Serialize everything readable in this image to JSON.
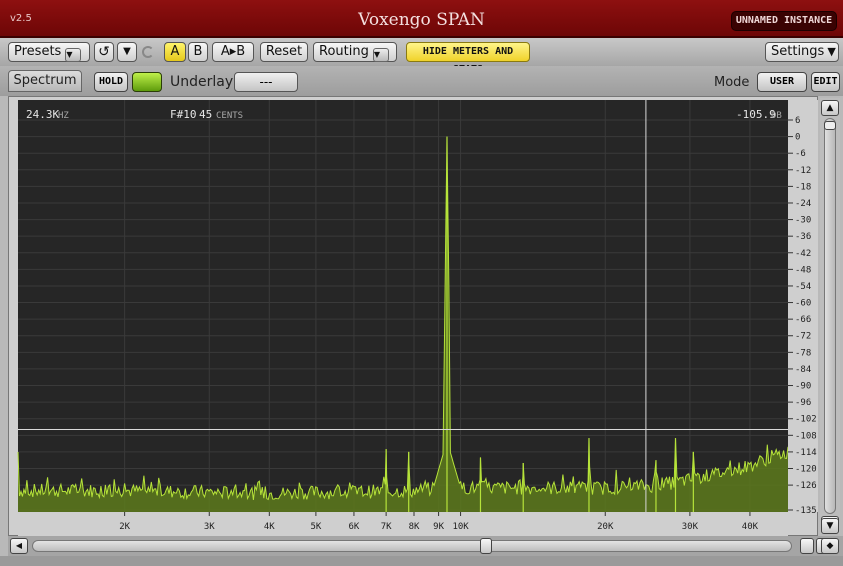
{
  "title_bar": {
    "version": "v2.5",
    "title": "Voxengo SPAN",
    "instance_label": "UNNAMED INSTANCE"
  },
  "toolbar": {
    "presets_label": "Presets",
    "undo_icon": "undo-icon",
    "a_label": "A",
    "b_label": "B",
    "a_to_b_label": "A▸B",
    "reset_label": "Reset",
    "routing_label": "Routing",
    "hide_meters_label": "HIDE METERS AND STATS",
    "settings_label": "Settings"
  },
  "view_bar": {
    "tab_label": "Spectrum",
    "hold_label": "HOLD",
    "underlay_label": "Underlay",
    "underlay_value": "---",
    "mode_label": "Mode",
    "mode_value": "USER",
    "edit_label": "EDIT"
  },
  "readout": {
    "frequency": "24.3K",
    "frequency_unit": "HZ",
    "note": "F#10",
    "cents": "45",
    "cents_unit": "CENTS",
    "level": "-105.9",
    "level_unit": "DB"
  },
  "colors": {
    "title_bar": "#7d0a0a",
    "plot_background": "#262626",
    "spectrum_line": "#b6e33a",
    "spectrum_fill": "#5d7a1c",
    "accent_yellow": "#f3d733"
  },
  "chart_data": {
    "type": "area",
    "x_scale": "log",
    "x_unit": "Hz",
    "y_unit": "dB",
    "xlim": [
      1200,
      48000
    ],
    "ylim": [
      -135,
      6
    ],
    "x_tick_labels": [
      "2K",
      "3K",
      "4K",
      "5K",
      "6K",
      "7K",
      "8K",
      "9K",
      "10K",
      "20K",
      "30K",
      "40K"
    ],
    "x_ticks": [
      2000,
      3000,
      4000,
      5000,
      6000,
      7000,
      8000,
      9000,
      10000,
      20000,
      30000,
      40000
    ],
    "y_ticks": [
      6,
      0,
      -6,
      -12,
      -18,
      -24,
      -30,
      -36,
      -42,
      -48,
      -54,
      -60,
      -66,
      -72,
      -78,
      -84,
      -90,
      -96,
      -102,
      -108,
      -114,
      -120,
      -126,
      -135
    ],
    "y_tick_labels": [
      "6",
      "0",
      "-6",
      "-12",
      "-18",
      "-24",
      "-30",
      "-36",
      "-42",
      "-48",
      "-54",
      "-60",
      "-66",
      "-72",
      "-78",
      "-84",
      "-90",
      "-96",
      "-102",
      "-108",
      "-114",
      "-120",
      "-126",
      "-135"
    ],
    "cursor": {
      "x": 24300,
      "y": -105.9
    },
    "noise_floor": [
      [
        1200,
        -128
      ],
      [
        2000,
        -128
      ],
      [
        4000,
        -129
      ],
      [
        8000,
        -128
      ],
      [
        9000,
        -127
      ],
      [
        10000,
        -127
      ],
      [
        20000,
        -127
      ],
      [
        26000,
        -126
      ],
      [
        30000,
        -124
      ],
      [
        36000,
        -121
      ],
      [
        40000,
        -119
      ],
      [
        44000,
        -116
      ],
      [
        48000,
        -114
      ]
    ],
    "peaks": [
      {
        "x": 9370,
        "y": 0
      },
      {
        "x": 7000,
        "y": -113
      },
      {
        "x": 7800,
        "y": -114
      },
      {
        "x": 11000,
        "y": -116
      },
      {
        "x": 18500,
        "y": -109
      },
      {
        "x": 28000,
        "y": -109
      },
      {
        "x": 13500,
        "y": -118
      },
      {
        "x": 25500,
        "y": -117
      },
      {
        "x": 30500,
        "y": -114
      }
    ],
    "grid": true,
    "legend": "none"
  }
}
